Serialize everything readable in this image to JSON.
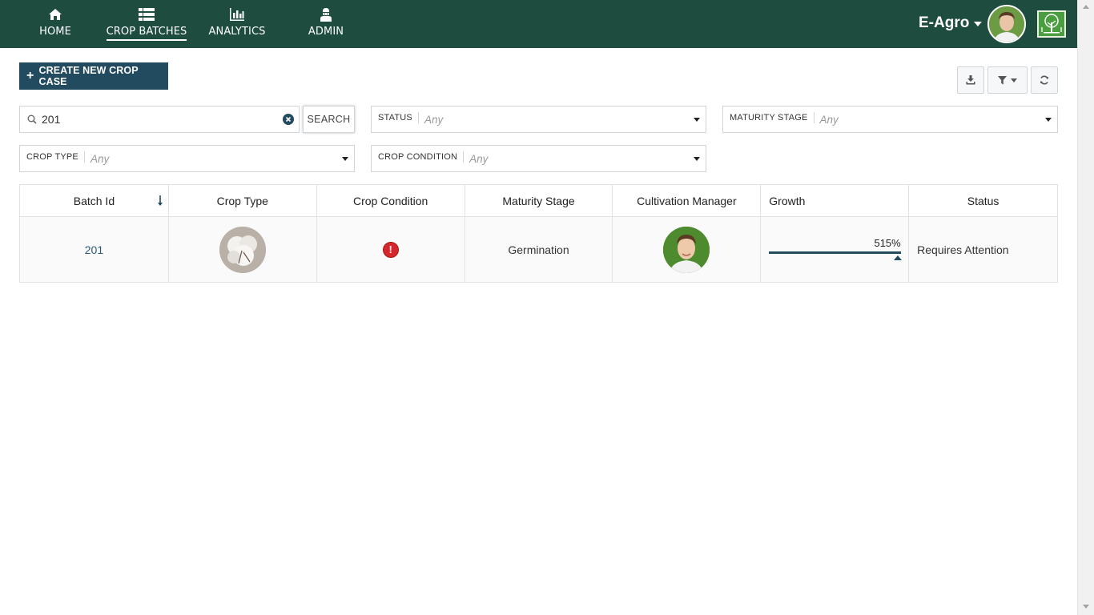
{
  "nav": {
    "items": [
      {
        "label": "HOME",
        "icon": "home-icon"
      },
      {
        "label": "CROP BATCHES",
        "icon": "list-icon",
        "active": true
      },
      {
        "label": "ANALYTICS",
        "icon": "bar-chart-icon"
      },
      {
        "label": "ADMIN",
        "icon": "admin-icon"
      }
    ],
    "brand": "E-Agro"
  },
  "toolbar": {
    "create_label": "CREATE NEW CROP CASE"
  },
  "search": {
    "value": "201",
    "button_label": "SEARCH"
  },
  "filters": {
    "status": {
      "label": "STATUS",
      "value": "Any"
    },
    "maturity": {
      "label": "MATURITY STAGE",
      "value": "Any"
    },
    "crop_type": {
      "label": "CROP TYPE",
      "value": "Any"
    },
    "crop_condition": {
      "label": "CROP CONDITION",
      "value": "Any"
    }
  },
  "table": {
    "headers": [
      "Batch Id",
      "Crop Type",
      "Crop Condition",
      "Maturity Stage",
      "Cultivation Manager",
      "Growth",
      "Status"
    ],
    "rows": [
      {
        "batch_id": "201",
        "crop_condition_icon": "alert-icon",
        "maturity_stage": "Germination",
        "growth": "515%",
        "growth_fraction": 1.0,
        "status": "Requires Attention"
      }
    ]
  },
  "colors": {
    "nav_bg": "#1e4d40",
    "primary": "#234b60",
    "alert": "#d4262b"
  }
}
